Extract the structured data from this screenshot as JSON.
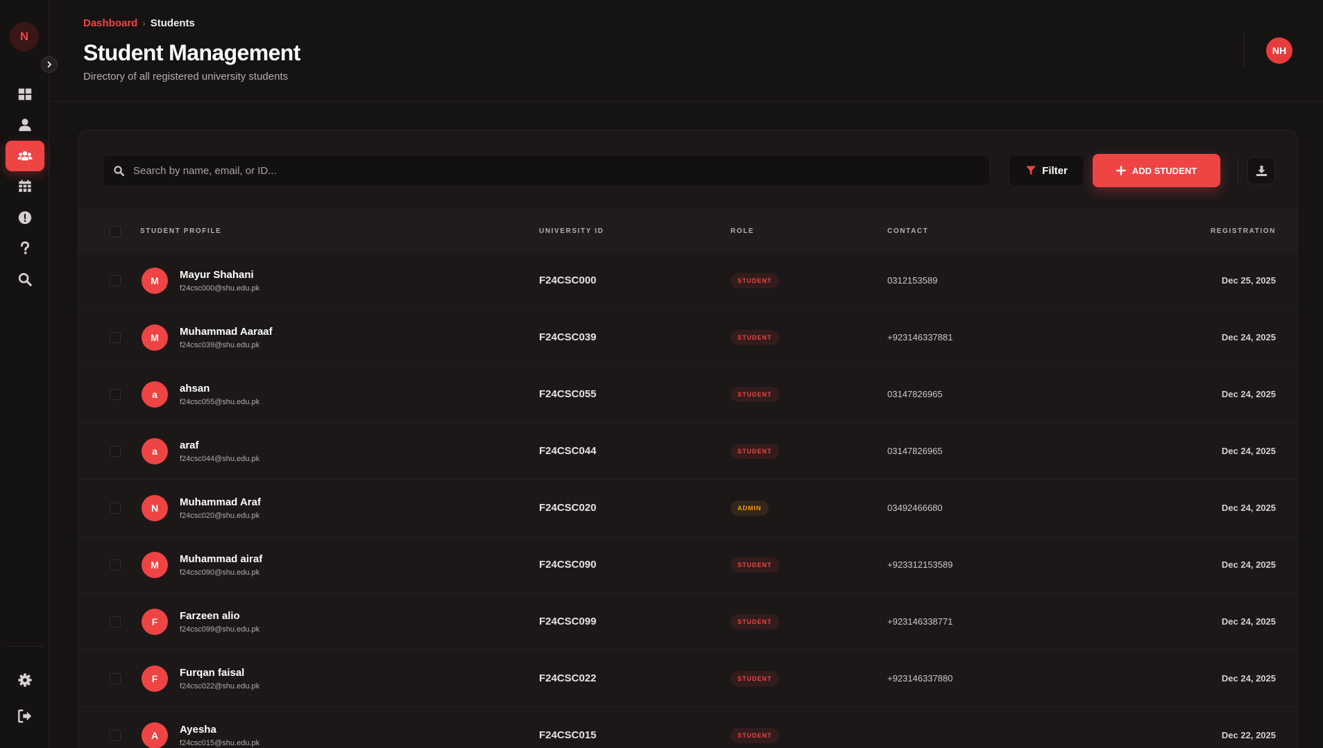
{
  "sidebar": {
    "logo_letter": "N",
    "nav": [
      {
        "icon": "dashboard-icon",
        "active": false
      },
      {
        "icon": "user-icon",
        "active": false
      },
      {
        "icon": "users-group-icon",
        "active": true
      },
      {
        "icon": "calendar-icon",
        "active": false
      },
      {
        "icon": "alert-icon",
        "active": false
      },
      {
        "icon": "help-icon",
        "active": false
      },
      {
        "icon": "search-icon",
        "active": false
      }
    ],
    "bottom": [
      {
        "icon": "gear-icon"
      },
      {
        "icon": "logout-icon"
      }
    ]
  },
  "header": {
    "breadcrumb": {
      "link": "Dashboard",
      "current": "Students"
    },
    "title": "Student Management",
    "subtitle": "Directory of all registered university students",
    "user_initials": "NH"
  },
  "toolbar": {
    "search_placeholder": "Search by name, email, or ID...",
    "filter_label": "Filter",
    "add_label": "ADD STUDENT"
  },
  "table": {
    "columns": {
      "profile": "STUDENT PROFILE",
      "id": "UNIVERSITY ID",
      "role": "ROLE",
      "contact": "CONTACT",
      "registration": "REGISTRATION"
    },
    "rows": [
      {
        "initial": "M",
        "name": "Mayur Shahani",
        "email": "f24csc000@shu.edu.pk",
        "id": "F24CSC000",
        "role": "STUDENT",
        "contact": "0312153589",
        "date": "Dec 25, 2025"
      },
      {
        "initial": "M",
        "name": "Muhammad Aaraaf",
        "email": "f24csc039@shu.edu.pk",
        "id": "F24CSC039",
        "role": "STUDENT",
        "contact": "+923146337881",
        "date": "Dec 24, 2025"
      },
      {
        "initial": "a",
        "name": "ahsan",
        "email": "f24csc055@shu.edu.pk",
        "id": "F24CSC055",
        "role": "STUDENT",
        "contact": "03147826965",
        "date": "Dec 24, 2025"
      },
      {
        "initial": "a",
        "name": "araf",
        "email": "f24csc044@shu.edu.pk",
        "id": "F24CSC044",
        "role": "STUDENT",
        "contact": "03147826965",
        "date": "Dec 24, 2025"
      },
      {
        "initial": "N",
        "name": "Muhammad Araf",
        "email": "f24csc020@shu.edu.pk",
        "id": "F24CSC020",
        "role": "ADMIN",
        "contact": "03492466680",
        "date": "Dec 24, 2025"
      },
      {
        "initial": "M",
        "name": "Muhammad airaf",
        "email": "f24csc090@shu.edu.pk",
        "id": "F24CSC090",
        "role": "STUDENT",
        "contact": "+923312153589",
        "date": "Dec 24, 2025"
      },
      {
        "initial": "F",
        "name": "Farzeen alio",
        "email": "f24csc099@shu.edu.pk",
        "id": "F24CSC099",
        "role": "STUDENT",
        "contact": "+923146338771",
        "date": "Dec 24, 2025"
      },
      {
        "initial": "F",
        "name": "Furqan faisal",
        "email": "f24csc022@shu.edu.pk",
        "id": "F24CSC022",
        "role": "STUDENT",
        "contact": "+923146337880",
        "date": "Dec 24, 2025"
      },
      {
        "initial": "A",
        "name": "Ayesha",
        "email": "f24csc015@shu.edu.pk",
        "id": "F24CSC015",
        "role": "STUDENT",
        "contact": "",
        "date": "Dec 22, 2025"
      }
    ]
  },
  "colors": {
    "accent": "#ef4444",
    "admin": "#f59e0b",
    "background": "#161313",
    "card": "#1c1818"
  }
}
